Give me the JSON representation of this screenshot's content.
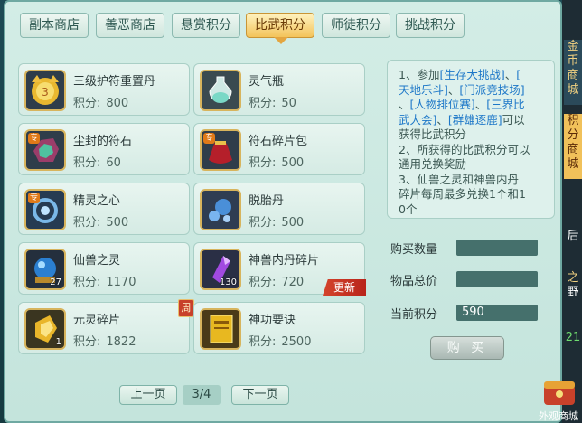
{
  "tabs": [
    {
      "label": "副本商店"
    },
    {
      "label": "善恶商店"
    },
    {
      "label": "悬赏积分"
    },
    {
      "label": "比武积分"
    },
    {
      "label": "师徒积分"
    },
    {
      "label": "挑战积分"
    }
  ],
  "price_label": "积分:",
  "items": [
    {
      "name": "三级护符重置丹",
      "price": "800",
      "icon": "medal-icon"
    },
    {
      "name": "灵气瓶",
      "price": "50",
      "icon": "spirit-bottle-icon"
    },
    {
      "name": "尘封的符石",
      "price": "60",
      "icon": "rune-stone-icon",
      "tag": "专"
    },
    {
      "name": "符石碎片包",
      "price": "500",
      "icon": "fragment-bag-icon",
      "tag": "专"
    },
    {
      "name": "精灵之心",
      "price": "500",
      "icon": "spirit-heart-icon",
      "tag": "专"
    },
    {
      "name": "脱胎丹",
      "price": "500",
      "icon": "rebirth-pill-icon"
    },
    {
      "name": "仙兽之灵",
      "price": "1170",
      "icon": "beast-orb-icon",
      "qty": "27"
    },
    {
      "name": "神兽内丹碎片",
      "price": "720",
      "icon": "crystal-shard-icon",
      "qty": "130",
      "badge": "更新"
    },
    {
      "name": "元灵碎片",
      "price": "1822",
      "icon": "yuanling-shard-icon",
      "qty": "1",
      "week": "周"
    },
    {
      "name": "神功要诀",
      "price": "2500",
      "icon": "skill-book-icon"
    }
  ],
  "info": {
    "l1a": "1、参加",
    "l1b": "[生存大挑战]",
    "l1c": "、",
    "l1d": "[",
    "l2a": "天地乐斗]",
    "l2b": "、",
    "l2c": "[门派竞技场]",
    "l3a": "、",
    "l3b": "[人物排位赛]",
    "l3c": "、",
    "l3d": "[三界比",
    "l4a": "武大会]",
    "l4b": "、",
    "l4c": "[群雄逐鹿]",
    "l4d": "可以",
    "l5": "获得比武积分",
    "l6": "2、所获得的比武积分可以",
    "l7": "通用兑换奖励",
    "l8": "3、仙兽之灵和神兽内丹",
    "l9": "碎片每周最多兑换1个和1",
    "l10": "0个"
  },
  "form": {
    "qty_label": "购买数量",
    "qty_value": "",
    "total_label": "物品总价",
    "total_value": "",
    "points_label": "当前积分",
    "points_value": "590"
  },
  "buy_label": "购 买",
  "pager": {
    "prev": "上一页",
    "page": "3/4",
    "next": "下一页"
  },
  "side": {
    "gold_mall": "金币商城",
    "points_mall": "积分商城",
    "right_cut": [
      "后",
      "之",
      "野",
      "21"
    ],
    "appearance": "外观商城"
  }
}
